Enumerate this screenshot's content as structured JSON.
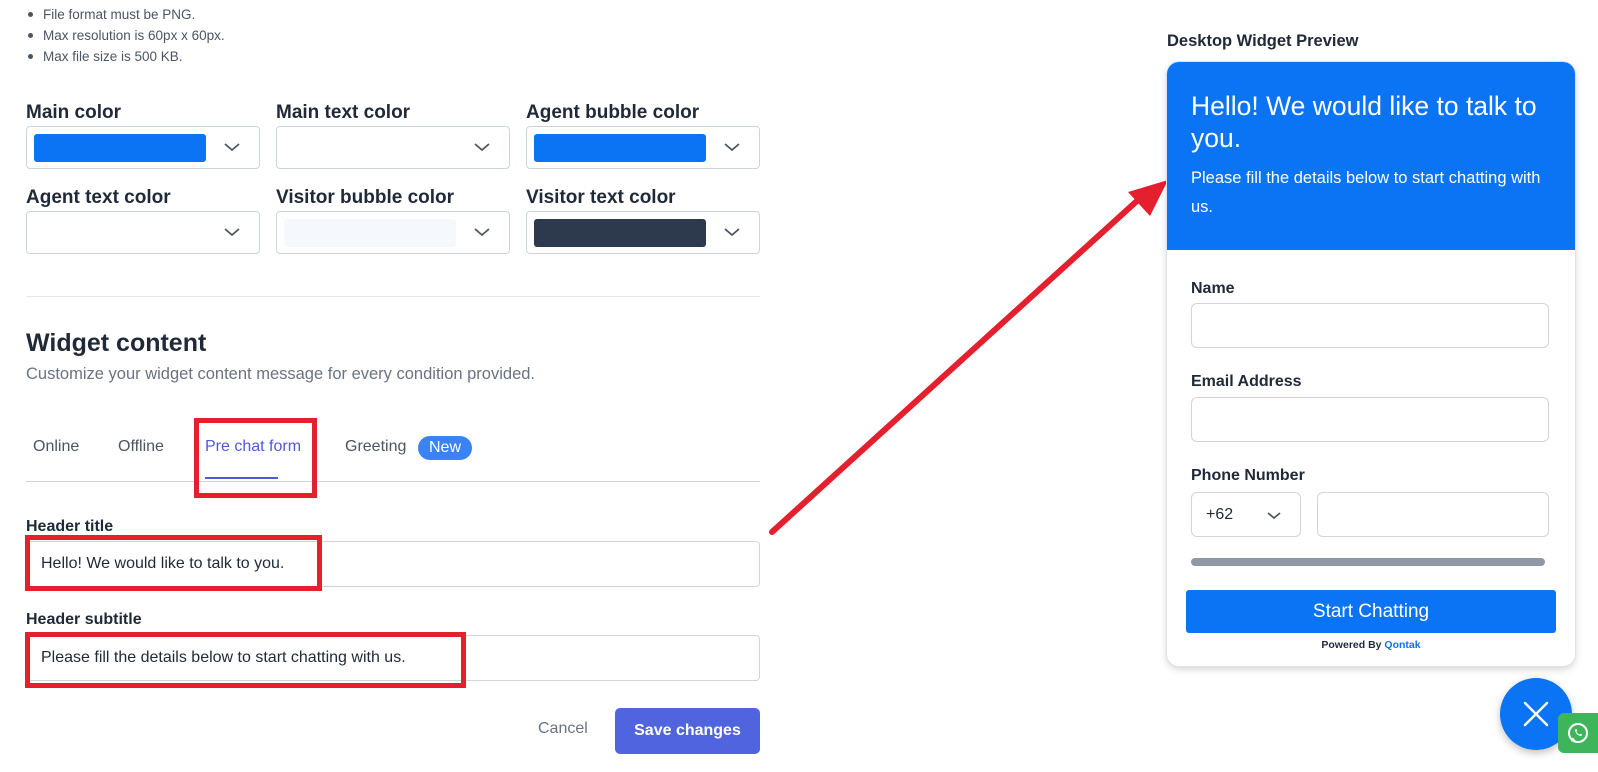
{
  "file_rules": [
    "File format must be PNG.",
    "Max resolution is 60px x 60px.",
    "Max file size is 500 KB."
  ],
  "colors": {
    "main_color": {
      "label": "Main color",
      "value": "#0a74f5"
    },
    "main_text_color": {
      "label": "Main text color",
      "value": "#ffffff"
    },
    "agent_bubble_color": {
      "label": "Agent bubble color",
      "value": "#0a74f5"
    },
    "agent_text_color": {
      "label": "Agent text color",
      "value": "#ffffff"
    },
    "visitor_bubble_color": {
      "label": "Visitor bubble color",
      "value": "#f5f8fd"
    },
    "visitor_text_color": {
      "label": "Visitor text color",
      "value": "#2d3a4d"
    }
  },
  "widget_content": {
    "title": "Widget content",
    "description": "Customize your widget content message for every condition provided.",
    "tabs": [
      {
        "label": "Online"
      },
      {
        "label": "Offline"
      },
      {
        "label": "Pre chat form",
        "active": true
      },
      {
        "label": "Greeting",
        "badge": "New"
      }
    ]
  },
  "form": {
    "header_title_label": "Header title",
    "header_title_value": "Hello! We would like to talk to you.",
    "header_subtitle_label": "Header subtitle",
    "header_subtitle_value": "Please fill the details below to start chatting with us.",
    "cancel_label": "Cancel",
    "save_label": "Save changes"
  },
  "preview": {
    "title": "Desktop Widget Preview",
    "header_title": "Hello! We would like to talk to you.",
    "header_subtitle": "Please fill the details below to start chatting with us.",
    "name_label": "Name",
    "email_label": "Email Address",
    "phone_label": "Phone Number",
    "country_code": "+62",
    "start_button": "Start Chatting",
    "powered_by": "Powered By",
    "brand": "Qontak"
  },
  "icons": {
    "dropdown": "chevron-down-icon",
    "close": "close-icon",
    "whatsapp": "whatsapp-icon"
  },
  "accent_colors": {
    "annotation_red": "#e5202e",
    "primary_blue": "#0a74f5",
    "button_indigo": "#5164e0"
  }
}
